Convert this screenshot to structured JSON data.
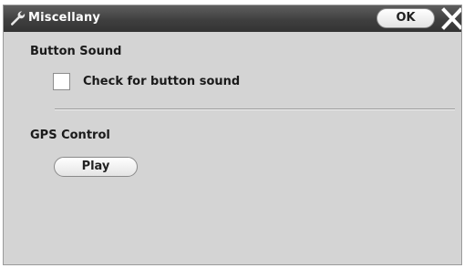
{
  "window": {
    "title": "Miscellany",
    "title_icon": "wrench-icon",
    "ok_label": "OK",
    "close_icon": "close-icon"
  },
  "sections": {
    "button_sound": {
      "heading": "Button Sound",
      "checkbox_label": "Check for button sound",
      "checked": false
    },
    "gps_control": {
      "heading": "GPS Control",
      "play_label": "Play"
    }
  },
  "colors": {
    "titlebar": "#3f3f3f",
    "window_bg": "#d4d4d4",
    "title_text": "#ffffff"
  }
}
